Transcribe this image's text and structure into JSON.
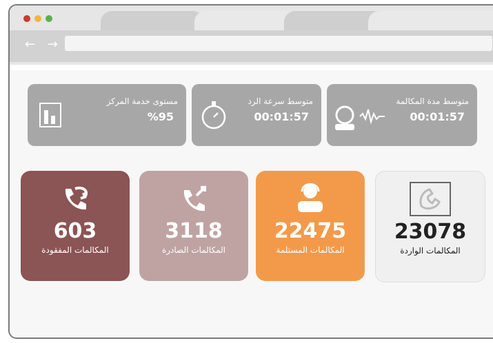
{
  "browser": {
    "nav_arrows": "← →",
    "dots": [
      "#c83c2c",
      "#f3b53d",
      "#57b34a"
    ]
  },
  "stats": [
    {
      "title": "متوسط مدة المكالمة",
      "value": "00:01:57",
      "icon": "headset-agent-icon"
    },
    {
      "title": "متوسط سرعة الرد",
      "value": "00:01:57",
      "icon": "stopwatch-icon"
    },
    {
      "title": "مستوى خدمة المركز",
      "value": "%95",
      "icon": "bar-chart-icon"
    }
  ],
  "tiles": [
    {
      "number": "23078",
      "label": "المكالمات الواردة",
      "bg": "#f0f0f0",
      "fg": "#222222",
      "icon": "incoming-phone-icon"
    },
    {
      "number": "22475",
      "label": "المكالمات المستلمة",
      "bg": "#f39a4a",
      "fg": "#ffffff",
      "icon": "call-agent-icon"
    },
    {
      "number": "3118",
      "label": "المكالمات الصادرة",
      "bg": "#bfa3a3",
      "fg": "#ffffff",
      "icon": "outgoing-call-icon"
    },
    {
      "number": "603",
      "label": "المكالمات المفقودة",
      "bg": "#8b5455",
      "fg": "#ffffff",
      "icon": "missed-call-icon"
    }
  ]
}
